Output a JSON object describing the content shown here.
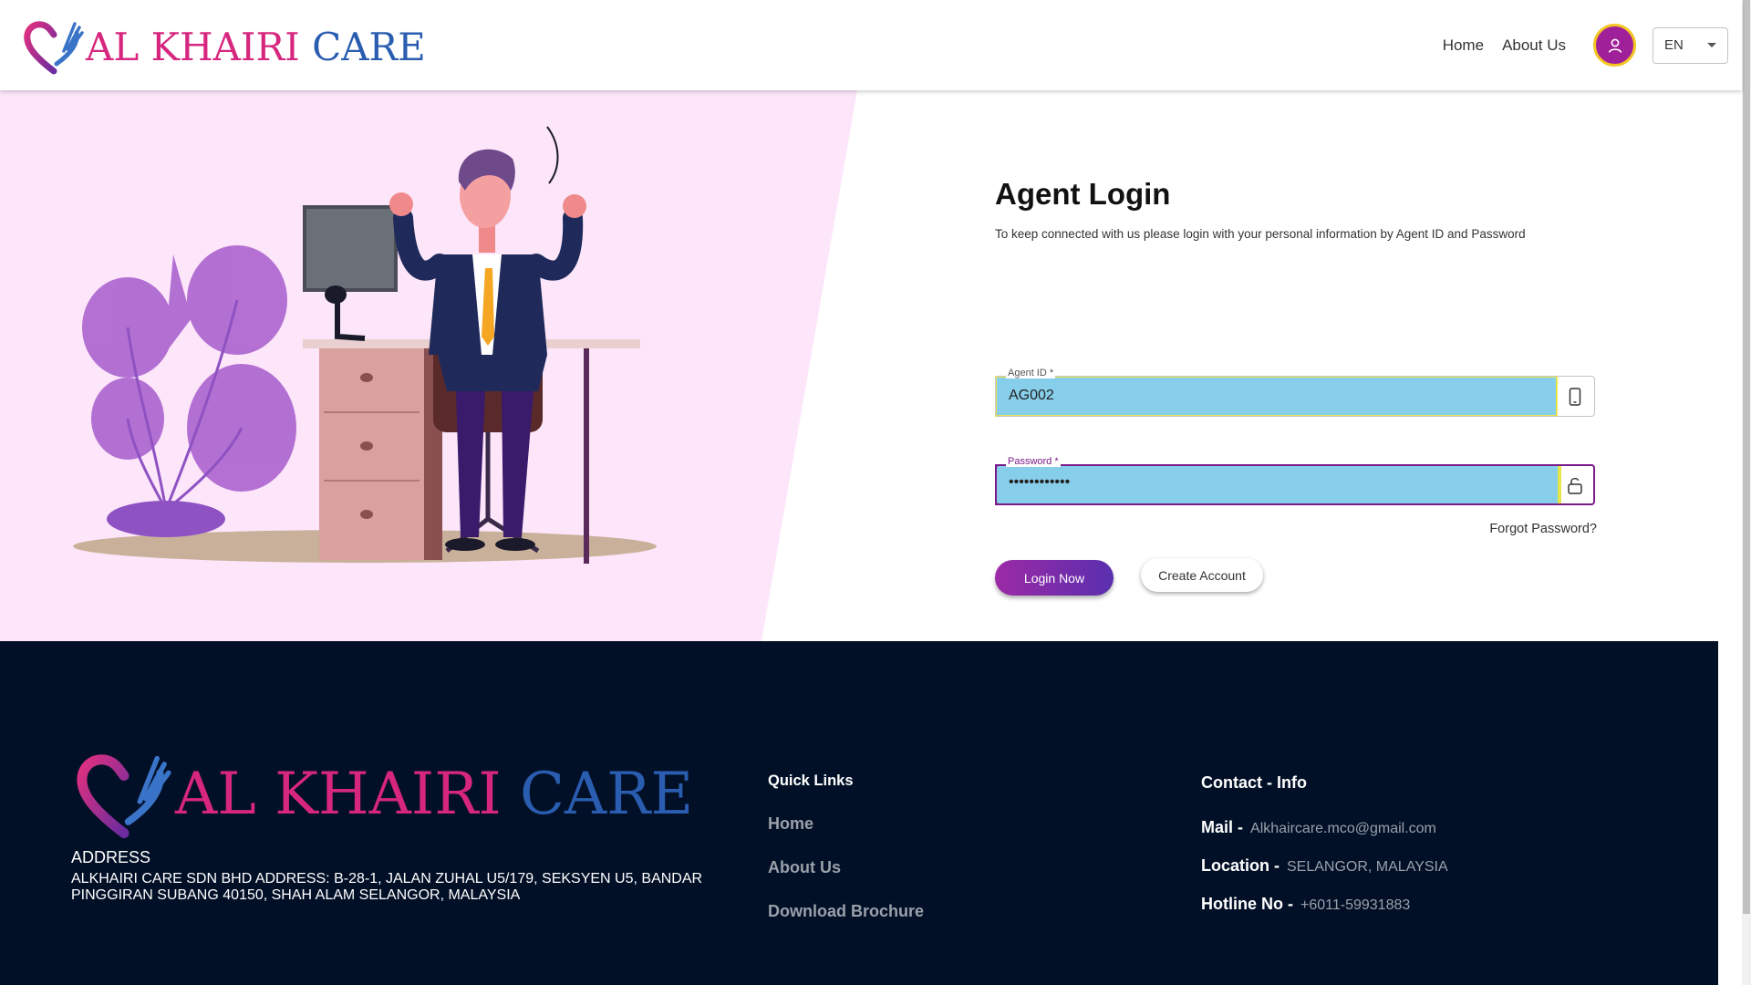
{
  "brand": {
    "part1": "AL KHAIRI",
    "part2": "CARE",
    "color_pink": "#d6267e",
    "color_blue": "#2a5db0"
  },
  "nav": {
    "home": "Home",
    "about": "About Us",
    "avatar_icon": "user-icon",
    "language": "EN"
  },
  "login": {
    "title": "Agent Login",
    "subtitle": "To keep connected with us please login with your personal information by Agent ID and Password",
    "agent_id": {
      "label": "Agent ID *",
      "value": "AG002",
      "icon": "mobile-phone-icon"
    },
    "password": {
      "label": "Password *",
      "value": "••••••••••••",
      "icon": "unlock-icon"
    },
    "forgot": "Forgot Password?",
    "login_button": "Login Now",
    "create_button": "Create Account"
  },
  "footer": {
    "address_heading": "ADDRESS",
    "address": "ALKHAIRI CARE SDN BHD ADDRESS: B-28-1, JALAN ZUHAL U5/179, SEKSYEN U5, BANDAR PINGGIRAN SUBANG 40150, SHAH ALAM SELANGOR, MALAYSIA",
    "quick_links_heading": "Quick Links",
    "quick_links": [
      "Home",
      "About Us",
      "Download Brochure"
    ],
    "contact_heading": "Contact - Info",
    "contact": [
      {
        "key": "Mail -",
        "value": "Alkhaircare.mco@gmail.com"
      },
      {
        "key": "Location -",
        "value": "SELANGOR, MALAYSIA"
      },
      {
        "key": "Hotline No -",
        "value": "+6011-59931883"
      }
    ]
  },
  "colors": {
    "accent_purple": "#9c2aa6",
    "footer_bg": "#021027",
    "field_fill": "#87ceeb",
    "hero_pink": "#fde6fa"
  }
}
